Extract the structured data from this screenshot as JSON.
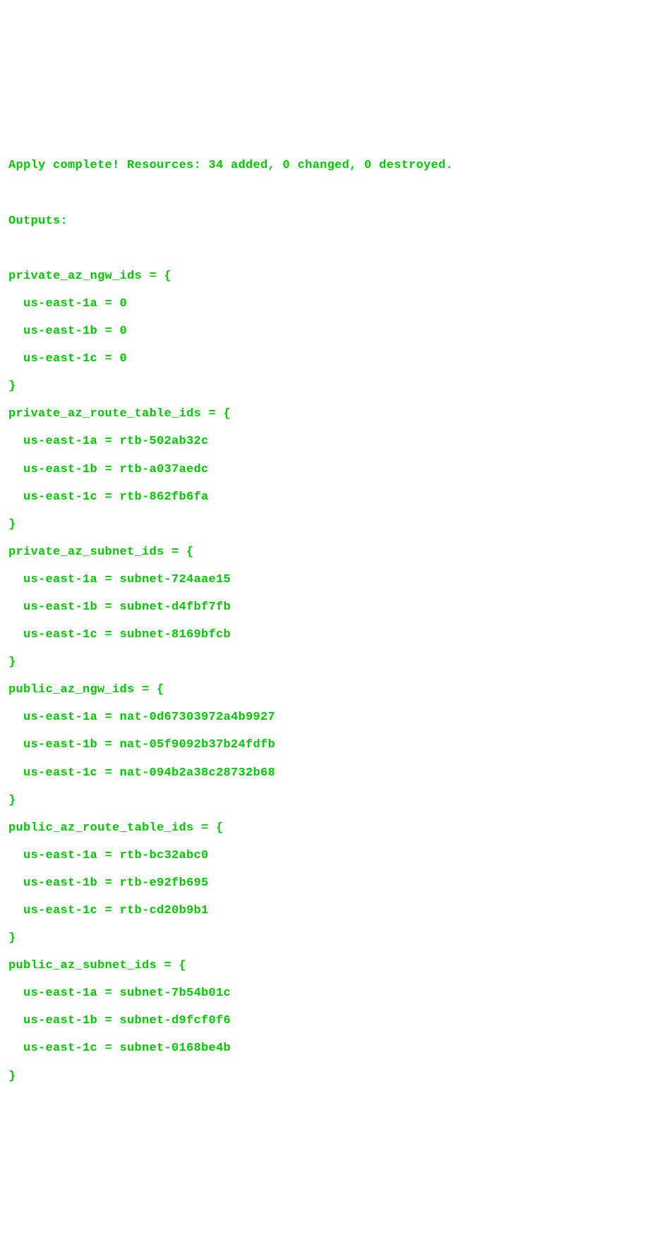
{
  "lines": {
    "l0": "Apply complete! Resources: 34 added, 0 changed, 0 destroyed.",
    "l1": "",
    "l2": "Outputs:",
    "l3": "",
    "l4": "private_az_ngw_ids = {",
    "l5": "  us-east-1a = 0",
    "l6": "  us-east-1b = 0",
    "l7": "  us-east-1c = 0",
    "l8": "}",
    "l9": "private_az_route_table_ids = {",
    "l10": "  us-east-1a = rtb-502ab32c",
    "l11": "  us-east-1b = rtb-a037aedc",
    "l12": "  us-east-1c = rtb-862fb6fa",
    "l13": "}",
    "l14": "private_az_subnet_ids = {",
    "l15": "  us-east-1a = subnet-724aae15",
    "l16": "  us-east-1b = subnet-d4fbf7fb",
    "l17": "  us-east-1c = subnet-8169bfcb",
    "l18": "}",
    "l19": "public_az_ngw_ids = {",
    "l20": "  us-east-1a = nat-0d67303972a4b9927",
    "l21": "  us-east-1b = nat-05f9092b37b24fdfb",
    "l22": "  us-east-1c = nat-094b2a38c28732b68",
    "l23": "}",
    "l24": "public_az_route_table_ids = {",
    "l25": "  us-east-1a = rtb-bc32abc0",
    "l26": "  us-east-1b = rtb-e92fb695",
    "l27": "  us-east-1c = rtb-cd20b9b1",
    "l28": "}",
    "l29": "public_az_subnet_ids = {",
    "l30": "  us-east-1a = subnet-7b54b01c",
    "l31": "  us-east-1b = subnet-d9fcf0f6",
    "l32": "  us-east-1c = subnet-0168be4b",
    "l33": "}"
  }
}
